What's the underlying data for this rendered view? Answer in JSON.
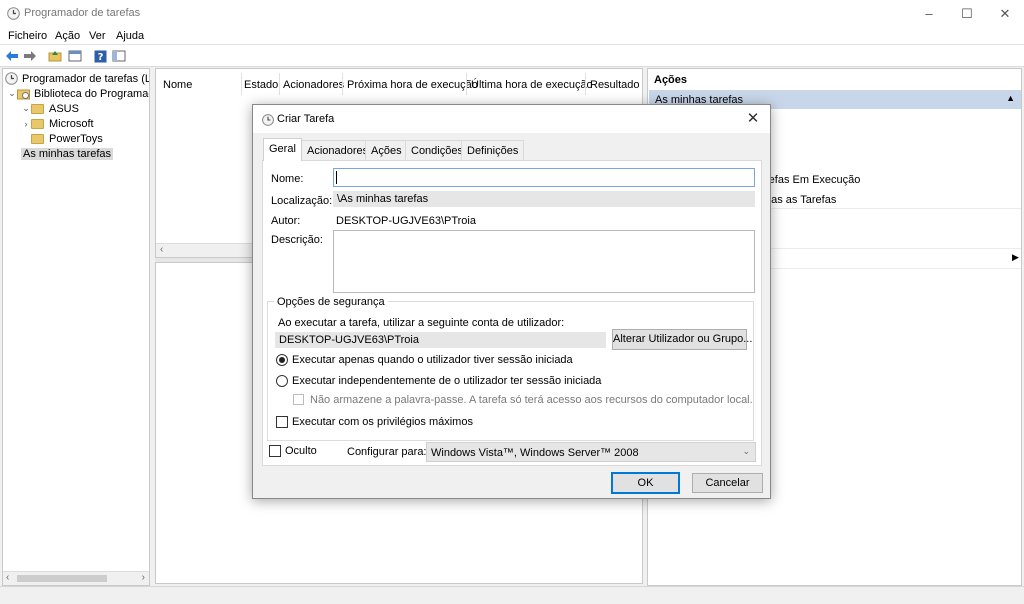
{
  "window": {
    "title": "Programador de tarefas",
    "controls": {
      "minimize": "–",
      "maximize": "☐",
      "close": "✕"
    }
  },
  "menu": [
    "Ficheiro",
    "Ação",
    "Ver",
    "Ajuda"
  ],
  "toolbar": {
    "icons": [
      "back-arrow-icon",
      "forward-arrow-icon",
      "folder-up-icon",
      "show-hide-console-icon",
      "help-icon",
      "properties-icon"
    ]
  },
  "tree": {
    "root": "Programador de tarefas (Local",
    "library": "Biblioteca do Programado",
    "items": [
      "ASUS",
      "Microsoft",
      "PowerToys",
      "As minhas tarefas"
    ]
  },
  "list": {
    "columns": [
      "Nome",
      "Estado",
      "Acionadores",
      "Próxima hora de execução",
      "Última hora de execução",
      "Resultado d"
    ]
  },
  "actions_panel": {
    "header": "Ações",
    "section": "As minhas tarefas",
    "visible_items": [
      "refas Em Execução",
      "nas as Tarefas"
    ]
  },
  "dialog": {
    "title": "Criar Tarefa",
    "tabs": [
      "Geral",
      "Acionadores",
      "Ações",
      "Condições",
      "Definições"
    ],
    "name_label": "Nome:",
    "name_value": "",
    "location_label": "Localização:",
    "location_value": "\\As minhas tarefas",
    "author_label": "Autor:",
    "author_value": "DESKTOP-UGJVE63\\PTroia",
    "description_label": "Descrição:",
    "description_value": "",
    "security": {
      "title": "Opções de segurança",
      "account_prompt": "Ao executar a tarefa, utilizar a seguinte conta de utilizador:",
      "account_value": "DESKTOP-UGJVE63\\PTroia",
      "change_button": "Alterar Utilizador ou Grupo...",
      "radio_logged_on": "Executar apenas quando o utilizador tiver sessão iniciada",
      "radio_whether": "Executar independentemente de o utilizador ter sessão iniciada",
      "no_store_password": "Não armazene a palavra-passe. A tarefa só terá acesso aos recursos do computador local.",
      "highest_privileges": "Executar com os privilégios máximos"
    },
    "hidden_label": "Oculto",
    "configure_label": "Configurar para:",
    "configure_value": "Windows Vista™, Windows Server™ 2008",
    "ok": "OK",
    "cancel": "Cancelar"
  }
}
